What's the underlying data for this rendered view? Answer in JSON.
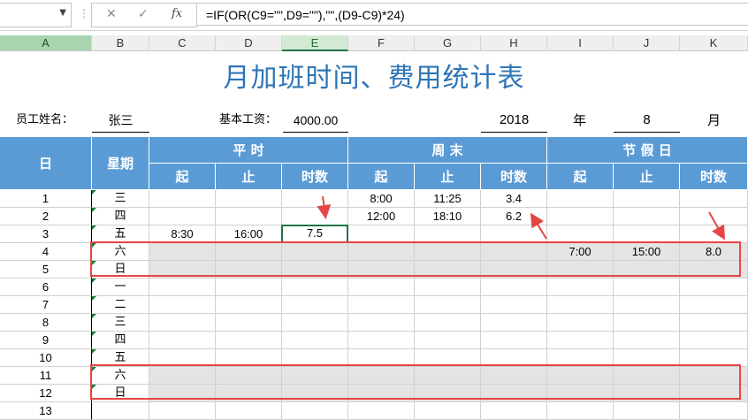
{
  "formula_bar": {
    "name_box": "",
    "cancel_icon": "✕",
    "enter_icon": "✓",
    "fx_label": "fx",
    "formula": "=IF(OR(C9=\"\",D9=\"\"),\"\",(D9-C9)*24)"
  },
  "columns": [
    "A",
    "B",
    "C",
    "D",
    "E",
    "F",
    "G",
    "H",
    "I",
    "J",
    "K"
  ],
  "sheet": {
    "title": "月加班时间、费用统计表",
    "employee_label": "员工姓名：",
    "employee_name": "张三",
    "salary_label": "基本工资：",
    "salary_value": "4000.00",
    "year": "2018",
    "year_label": "年",
    "month": "8",
    "month_label": "月",
    "header": {
      "day": "日",
      "weekday": "星期",
      "weekday_group": "平 时",
      "weekend_group": "周 末",
      "holiday_group": "节 假 日",
      "start": "起",
      "end": "止",
      "hours": "时数"
    },
    "rows": [
      {
        "day": "1",
        "wd": "三",
        "c": "",
        "d": "",
        "e": "",
        "f": "8:00",
        "g": "11:25",
        "h": "3.4",
        "i": "",
        "j": "",
        "k": ""
      },
      {
        "day": "2",
        "wd": "四",
        "c": "",
        "d": "",
        "e": "",
        "f": "12:00",
        "g": "18:10",
        "h": "6.2",
        "i": "",
        "j": "",
        "k": ""
      },
      {
        "day": "3",
        "wd": "五",
        "c": "8:30",
        "d": "16:00",
        "e": "7.5",
        "f": "",
        "g": "",
        "h": "",
        "i": "",
        "j": "",
        "k": ""
      },
      {
        "day": "4",
        "wd": "六",
        "c": "",
        "d": "",
        "e": "",
        "f": "",
        "g": "",
        "h": "",
        "i": "7:00",
        "j": "15:00",
        "k": "8.0"
      },
      {
        "day": "5",
        "wd": "日",
        "c": "",
        "d": "",
        "e": "",
        "f": "",
        "g": "",
        "h": "",
        "i": "",
        "j": "",
        "k": ""
      },
      {
        "day": "6",
        "wd": "一",
        "c": "",
        "d": "",
        "e": "",
        "f": "",
        "g": "",
        "h": "",
        "i": "",
        "j": "",
        "k": ""
      },
      {
        "day": "7",
        "wd": "二",
        "c": "",
        "d": "",
        "e": "",
        "f": "",
        "g": "",
        "h": "",
        "i": "",
        "j": "",
        "k": ""
      },
      {
        "day": "8",
        "wd": "三",
        "c": "",
        "d": "",
        "e": "",
        "f": "",
        "g": "",
        "h": "",
        "i": "",
        "j": "",
        "k": ""
      },
      {
        "day": "9",
        "wd": "四",
        "c": "",
        "d": "",
        "e": "",
        "f": "",
        "g": "",
        "h": "",
        "i": "",
        "j": "",
        "k": ""
      },
      {
        "day": "10",
        "wd": "五",
        "c": "",
        "d": "",
        "e": "",
        "f": "",
        "g": "",
        "h": "",
        "i": "",
        "j": "",
        "k": ""
      },
      {
        "day": "11",
        "wd": "六",
        "c": "",
        "d": "",
        "e": "",
        "f": "",
        "g": "",
        "h": "",
        "i": "",
        "j": "",
        "k": ""
      },
      {
        "day": "12",
        "wd": "日",
        "c": "",
        "d": "",
        "e": "",
        "f": "",
        "g": "",
        "h": "",
        "i": "",
        "j": "",
        "k": ""
      },
      {
        "day": "13",
        "wd": "",
        "c": "",
        "d": "",
        "e": "",
        "f": "",
        "g": "",
        "h": "",
        "i": "",
        "j": "",
        "k": ""
      }
    ]
  },
  "colors": {
    "header_blue": "#5b9bd5",
    "title_blue": "#2e75b6",
    "weekend_gray": "#e4e4e4",
    "annotation_red": "#e64545",
    "selection_green": "#217346"
  }
}
